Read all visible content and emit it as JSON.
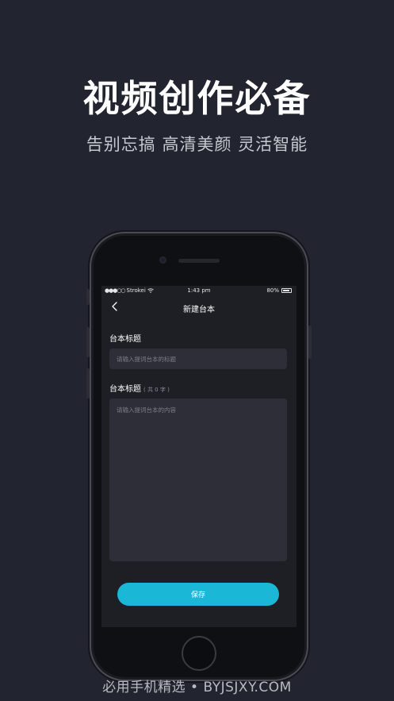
{
  "hero": {
    "title": "视频创作必备",
    "subtitle": "告别忘搞 高清美颜 灵活智能"
  },
  "phone": {
    "status_bar": {
      "signal_dots": "●●●○○",
      "carrier": "Strokei",
      "wifi_icon": "wifi-icon",
      "time": "1:43 pm",
      "battery_percent": "80%",
      "battery_icon": "battery-icon"
    },
    "nav": {
      "back_icon": "chevron-left-icon",
      "title": "新建台本"
    },
    "form": {
      "title_label": "台本标题",
      "title_placeholder": "请输入提词台本的标题",
      "content_label": "台本标题",
      "content_count": "( 共 0 字 )",
      "content_placeholder": "请输入提词台本的内容",
      "save_label": "保存"
    }
  },
  "colors": {
    "background": "#22242f",
    "accent": "#1ab8d6",
    "screen": "#1e1f25",
    "field": "#2d2e37"
  },
  "watermark": "必用手机精选 • BYJSJXY.COM"
}
